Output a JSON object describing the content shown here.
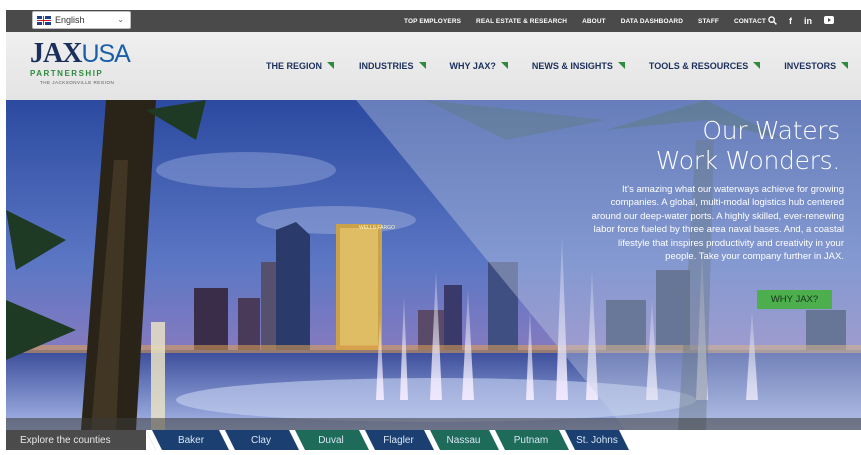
{
  "language_selector": {
    "value": "English"
  },
  "utility_nav": {
    "links": [
      "TOP EMPLOYERS",
      "REAL ESTATE & RESEARCH",
      "ABOUT",
      "DATA DASHBOARD",
      "STAFF",
      "CONTACT"
    ],
    "icons": [
      "search-icon",
      "facebook-icon",
      "linkedin-icon",
      "youtube-icon"
    ],
    "social_glyphs": {
      "facebook": "f",
      "linkedin": "in",
      "youtube": "▶"
    }
  },
  "logo": {
    "jax": "JAX",
    "usa": "USA",
    "partnership": "PARTNERSHIP",
    "tagline": "THE JACKSONVILLE REGION"
  },
  "main_nav": {
    "items": [
      "THE REGION",
      "INDUSTRIES",
      "WHY JAX?",
      "NEWS & INSIGHTS",
      "TOOLS & RESOURCES",
      "INVESTORS"
    ]
  },
  "hero": {
    "title_line1": "Our Waters",
    "title_line2": "Work Wonders.",
    "body": "It's amazing what our waterways achieve for growing companies. A global, multi-modal logistics hub centered around our deep-water ports. A highly skilled, ever-renewing labor force fueled by three area naval bases. And, a coastal lifestyle that inspires productivity and creativity in your people. Take your company further in JAX.",
    "cta": "WHY JAX?",
    "building_sign": "WELLS FARGO"
  },
  "counties": {
    "label": "Explore the counties",
    "items": [
      "Baker",
      "Clay",
      "Duval",
      "Flagler",
      "Nassau",
      "Putnam",
      "St. Johns"
    ]
  },
  "colors": {
    "topbar": "#4a4a4a",
    "navy": "#1b2f5b",
    "green": "#2e8b3e",
    "cta_green": "#4cae4c",
    "county_blue": "#1c3f72",
    "county_green": "#1f6b5a"
  }
}
